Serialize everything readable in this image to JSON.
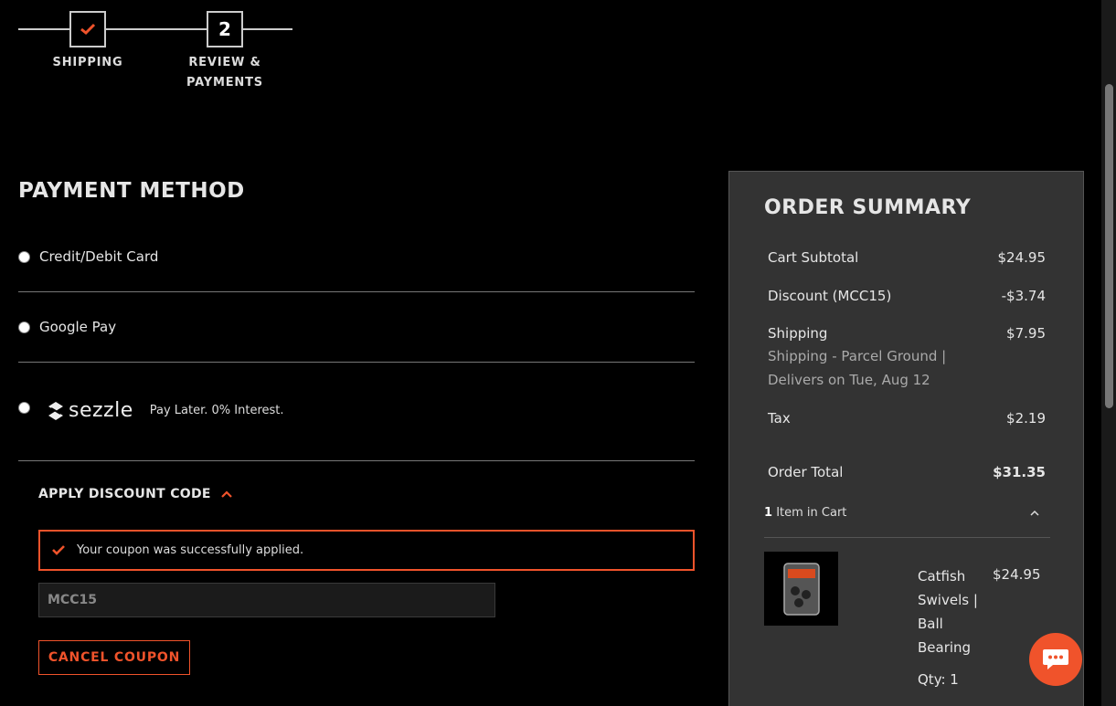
{
  "stepper": {
    "steps": [
      {
        "label_line1": "SHIPPING",
        "label_line2": "",
        "state": "complete"
      },
      {
        "number": "2",
        "label_line1": "REVIEW &",
        "label_line2": "PAYMENTS",
        "state": "current"
      }
    ]
  },
  "payment": {
    "title": "PAYMENT METHOD",
    "options": [
      {
        "label": "Credit/Debit Card"
      },
      {
        "label": "Google Pay"
      },
      {
        "logo_text": "sezzle",
        "label": "Pay Later. 0% Interest."
      }
    ]
  },
  "discount": {
    "title": "APPLY DISCOUNT CODE",
    "success_message": "Your coupon was successfully applied.",
    "code_value": "MCC15",
    "cancel_label": "CANCEL COUPON"
  },
  "summary": {
    "title": "ORDER SUMMARY",
    "rows": [
      {
        "label": "Cart Subtotal",
        "value": "$24.95"
      },
      {
        "label": "Discount (MCC15)",
        "value": "-$3.74"
      },
      {
        "label": "Shipping",
        "value": "$7.95",
        "detail": "Shipping - Parcel Ground | Delivers on Tue, Aug 12"
      },
      {
        "label": "Tax",
        "value": "$2.19"
      }
    ],
    "total_label": "Order Total",
    "total_value": "$31.35",
    "cart_count": "1",
    "cart_label": "Item in Cart",
    "item": {
      "name": "Catfish Swivels | Ball Bearing",
      "price": "$24.95",
      "qty": "Qty: 1"
    }
  },
  "colors": {
    "accent": "#f0532b",
    "panel": "#333333",
    "background": "#000000"
  },
  "icons": {
    "check": "check-icon",
    "chevron_up": "chevron-up-icon",
    "chat": "chat-icon"
  }
}
